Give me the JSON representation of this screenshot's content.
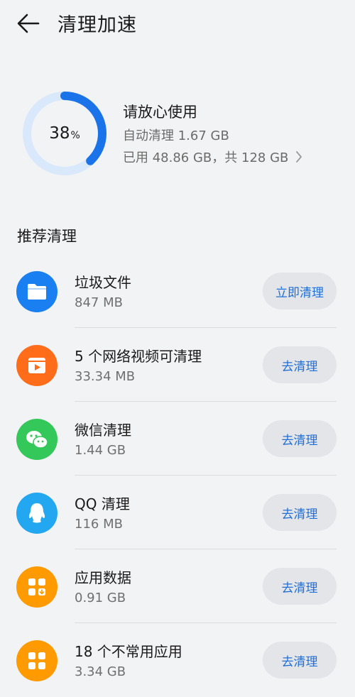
{
  "header": {
    "title": "清理加速",
    "back_icon": "arrow-left-icon"
  },
  "storage": {
    "percent_number": "38",
    "percent_sign": "%",
    "percent_value": 38,
    "status": "请放心使用",
    "auto_clean": "自动清理 1.67 GB",
    "used_total": "已用 48.86 GB，共 128 GB",
    "ring_color": "#1a73e8",
    "ring_track_color": "#d9e8fb"
  },
  "section_title": "推荐清理",
  "items": [
    {
      "name": "垃圾文件",
      "size": "847 MB",
      "button": "立即清理",
      "icon": "folder-icon",
      "color": "#1a7ff0"
    },
    {
      "name": "5 个网络视频可清理",
      "size": "33.34 MB",
      "button": "去清理",
      "icon": "video-icon",
      "color": "#ff6d1a"
    },
    {
      "name": "微信清理",
      "size": "1.44 GB",
      "button": "去清理",
      "icon": "wechat-icon",
      "color": "#34c759"
    },
    {
      "name": "QQ 清理",
      "size": "116 MB",
      "button": "去清理",
      "icon": "qq-icon",
      "color": "#22a7f0"
    },
    {
      "name": "应用数据",
      "size": "0.91 GB",
      "button": "去清理",
      "icon": "app-data-icon",
      "color": "#ff9a00"
    },
    {
      "name": "18 个不常用应用",
      "size": "3.34 GB",
      "button": "去清理",
      "icon": "apps-grid-icon",
      "color": "#ff9a00"
    }
  ]
}
